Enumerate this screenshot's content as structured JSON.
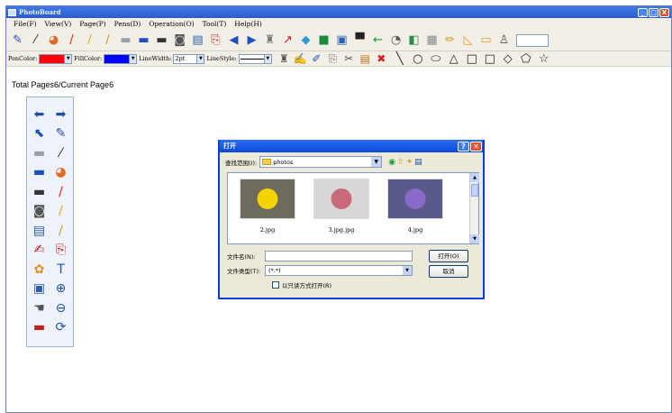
{
  "window": {
    "title": "PhotoBoard",
    "controls": [
      "_",
      "□",
      "X"
    ]
  },
  "menu": [
    "File(F)",
    "View(V)",
    "Page(P)",
    "Pens(D)",
    "Operation(O)",
    "Tool(T)",
    "Help(H)"
  ],
  "toolbar1": {
    "icons": [
      {
        "name": "pen-icon",
        "glyph": "✎",
        "color": "#2a4fb0"
      },
      {
        "name": "brush-icon",
        "glyph": "⁄",
        "color": "#333"
      },
      {
        "name": "palette-icon",
        "glyph": "◕",
        "color": "#e06a20"
      },
      {
        "name": "red-pen-icon",
        "glyph": "/",
        "color": "#e02020"
      },
      {
        "name": "yellow-pen-icon",
        "glyph": "/",
        "color": "#e0b020"
      },
      {
        "name": "marker-icon",
        "glyph": "/",
        "color": "#d09a20"
      },
      {
        "name": "eraser-icon",
        "glyph": "▬",
        "color": "#9aa0a8"
      },
      {
        "name": "blue-rect-icon",
        "glyph": "▬",
        "color": "#1a4fc0"
      },
      {
        "name": "dark-rect-icon",
        "glyph": "▬",
        "color": "#333"
      },
      {
        "name": "screen-capture-icon",
        "glyph": "◙",
        "color": "#555"
      },
      {
        "name": "window-icon",
        "glyph": "▤",
        "color": "#2a5fb0"
      },
      {
        "name": "new-page-icon",
        "glyph": "⎘",
        "color": "#c02020"
      },
      {
        "name": "prev-page-icon",
        "glyph": "◀",
        "color": "#2050c0"
      },
      {
        "name": "next-page-icon",
        "glyph": "▶",
        "color": "#2050c0"
      },
      {
        "name": "trash-icon",
        "glyph": "♜",
        "color": "#777"
      },
      {
        "name": "pointer-icon",
        "glyph": "↗",
        "color": "#c02020"
      },
      {
        "name": "diamond-icon",
        "glyph": "◆",
        "color": "#2a9fd0"
      },
      {
        "name": "green-square-icon",
        "glyph": "■",
        "color": "#1a8a3a"
      },
      {
        "name": "image-icon",
        "glyph": "▣",
        "color": "#2a5fb0"
      },
      {
        "name": "monitor-icon",
        "glyph": "▀",
        "color": "#222"
      },
      {
        "name": "back-arrow-icon",
        "glyph": "←",
        "color": "#1a9a2a"
      },
      {
        "name": "clock-icon",
        "glyph": "◔",
        "color": "#555"
      },
      {
        "name": "chart-icon",
        "glyph": "◧",
        "color": "#2a8a4a"
      },
      {
        "name": "gallery-icon",
        "glyph": "▦",
        "color": "#888"
      },
      {
        "name": "pencil-icon",
        "glyph": "✏",
        "color": "#d0a020"
      },
      {
        "name": "triangle-ruler-icon",
        "glyph": "◺",
        "color": "#e0a020"
      },
      {
        "name": "box-icon",
        "glyph": "▭",
        "color": "#e0a020"
      },
      {
        "name": "person-icon",
        "glyph": "♙",
        "color": "#555"
      }
    ]
  },
  "toolbar2": {
    "pen_color_label": "PenColor:",
    "pen_color": "#ff0000",
    "fill_color_label": "FillColor:",
    "fill_color": "#0000ff",
    "line_width_label": "LineWidth:",
    "line_width_value": "2pt",
    "line_style_label": "LineStyle:",
    "icons": [
      {
        "name": "bucket-icon",
        "glyph": "♜",
        "color": "#555"
      },
      {
        "name": "edit-doc-icon",
        "glyph": "✍",
        "color": "#c02020"
      },
      {
        "name": "highlighter-icon",
        "glyph": "✐",
        "color": "#2050c0"
      },
      {
        "name": "copy-icon",
        "glyph": "⎘",
        "color": "#777"
      },
      {
        "name": "cut-icon",
        "glyph": "✂",
        "color": "#555"
      },
      {
        "name": "paste-icon",
        "glyph": "▤",
        "color": "#c07020"
      },
      {
        "name": "delete-icon",
        "glyph": "✖",
        "color": "#d02020"
      }
    ],
    "shapes": [
      {
        "name": "line-shape-icon",
        "glyph": "╲"
      },
      {
        "name": "circle-shape-icon",
        "glyph": "○"
      },
      {
        "name": "ellipse-shape-icon",
        "glyph": "⬭"
      },
      {
        "name": "triangle-shape-icon",
        "glyph": "△"
      },
      {
        "name": "rectangle-shape-icon",
        "glyph": "□"
      },
      {
        "name": "square-shape-icon",
        "glyph": "□"
      },
      {
        "name": "diamond-shape-icon",
        "glyph": "◇"
      },
      {
        "name": "pentagon-shape-icon",
        "glyph": "⬠"
      },
      {
        "name": "star-shape-icon",
        "glyph": "☆"
      }
    ]
  },
  "status": {
    "text": "Total Pages6/Current Page6"
  },
  "palette": {
    "icons": [
      {
        "name": "undo-arrow-icon",
        "glyph": "⬅",
        "color": "#2050a0"
      },
      {
        "name": "redo-arrow-icon",
        "glyph": "➡",
        "color": "#2050a0"
      },
      {
        "name": "select-arrow-icon",
        "glyph": "⬉",
        "color": "#2050a0"
      },
      {
        "name": "pen-icon",
        "glyph": "✎",
        "color": "#2a4fb0"
      },
      {
        "name": "eraser-icon",
        "glyph": "▬",
        "color": "#9aa0a8"
      },
      {
        "name": "brush-icon",
        "glyph": "⁄",
        "color": "#333"
      },
      {
        "name": "blue-rect-icon",
        "glyph": "▬",
        "color": "#1a4fc0"
      },
      {
        "name": "palette-icon",
        "glyph": "◕",
        "color": "#e06a20"
      },
      {
        "name": "dark-rect-icon",
        "glyph": "▬",
        "color": "#333"
      },
      {
        "name": "red-pen-icon",
        "glyph": "/",
        "color": "#e02020"
      },
      {
        "name": "screen-capture-icon",
        "glyph": "◙",
        "color": "#555"
      },
      {
        "name": "yellow-pen-icon",
        "glyph": "/",
        "color": "#e0b020"
      },
      {
        "name": "window-icon",
        "glyph": "▤",
        "color": "#2a5fb0"
      },
      {
        "name": "marker-icon",
        "glyph": "/",
        "color": "#d09a20"
      },
      {
        "name": "edit-doc-icon",
        "glyph": "✍",
        "color": "#c02020"
      },
      {
        "name": "page-icon",
        "glyph": "⎘",
        "color": "#c02020"
      },
      {
        "name": "flower-stamp-icon",
        "glyph": "✿",
        "color": "#e09020"
      },
      {
        "name": "text-icon",
        "glyph": "T",
        "color": "#2050c0"
      },
      {
        "name": "image-icon",
        "glyph": "▣",
        "color": "#2a5fb0"
      },
      {
        "name": "zoom-in-icon",
        "glyph": "⊕",
        "color": "#2050a0"
      },
      {
        "name": "hand-icon",
        "glyph": "☚",
        "color": "#555"
      },
      {
        "name": "zoom-out-icon",
        "glyph": "⊖",
        "color": "#2050a0"
      },
      {
        "name": "stack-icon",
        "glyph": "▬",
        "color": "#c02020"
      },
      {
        "name": "refresh-icon",
        "glyph": "⟳",
        "color": "#2050a0"
      }
    ]
  },
  "dialog": {
    "title": "打开",
    "lookin_label": "查找范围(I):",
    "lookin_value": "photos",
    "files": [
      {
        "name": "2.jpg",
        "bg": "#6e6a5e",
        "accent": "#f4d400"
      },
      {
        "name": "3.jpg.jpg",
        "bg": "#d8d8d8",
        "accent": "#c86a7a"
      },
      {
        "name": "4.jpg",
        "bg": "#5a5a8a",
        "accent": "#8a6ac8"
      }
    ],
    "filename_label": "文件名(N):",
    "filename_value": "",
    "filetype_label": "文件类型(T):",
    "filetype_value": "(*.*)",
    "open_label": "打开(O)",
    "cancel_label": "取消",
    "readonly_label": "以只读方式打开(R)"
  }
}
